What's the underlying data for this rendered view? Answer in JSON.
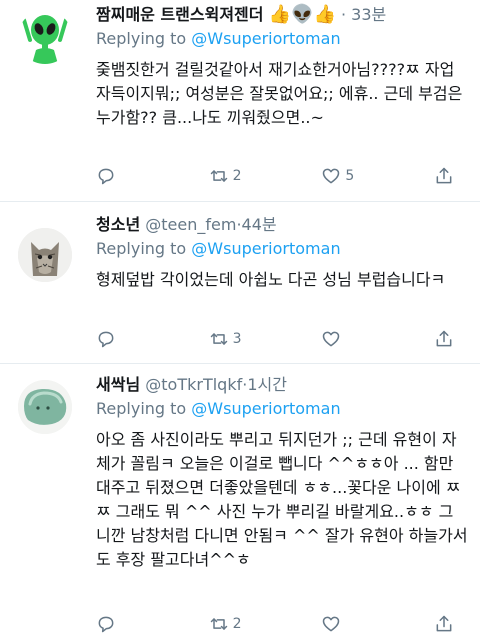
{
  "tweets": [
    {
      "name": "짬찌매운 트랜스윅져젠더",
      "name_emojis": [
        "👍",
        "👽",
        "👍"
      ],
      "handle": "",
      "separator": "·",
      "time": "33분",
      "replying_prefix": "Replying to",
      "replying_handle": "@Wsuperiortoman",
      "text": "줒뱀짓한거 걸릴것같아서 재기쇼한거아님????ㅉ 자업자득이지뭐;; 여성분은 잘못없어요;; 에휴.. 근데 부검은 누가함?? 큼...나도 끼워줬으면..~",
      "replies": "",
      "retweets": "2",
      "likes": "5",
      "avatar_icon": "alien-icon"
    },
    {
      "name": "청소년",
      "handle": "@teen_fem",
      "separator": "·",
      "time": "44분",
      "replying_prefix": "Replying to",
      "replying_handle": "@Wsuperiortoman",
      "text": "형제덮밥 각이었는데 아쉽노 다곤 성님 부럽습니다ㅋ",
      "replies": "",
      "retweets": "3",
      "likes": "",
      "avatar_icon": "cat-icon"
    },
    {
      "name": "새싹님",
      "handle": "@toTkrTlqkf",
      "separator": "·",
      "time": "1시간",
      "replying_prefix": "Replying to",
      "replying_handle": "@Wsuperiortoman",
      "text": "아오 좀 사진이라도 뿌리고 뒤지던가 ;; 근데 유현이 자체가 꼴림ㅋ 오늘은 이걸로 뺍니다 ^^ㅎㅎ아 ... 함만 대주고 뒤졌으면 더좋았을텐데 ㅎㅎ...꽃다운 나이에 ㅉㅉ 그래도 뭐 ^^ 사진 누가 뿌리길 바랄게요..ㅎㅎ 그니깐 남창처럼 다니면 안됨ㅋ ^^ 잘가 유현아 하늘가서도 후장 팔고다녀^^ㅎ",
      "replies": "",
      "retweets": "2",
      "likes": "",
      "avatar_icon": "blob-icon"
    }
  ],
  "colors": {
    "link": "#1da1f2",
    "muted": "#657786",
    "divider": "#e6ecf0"
  }
}
